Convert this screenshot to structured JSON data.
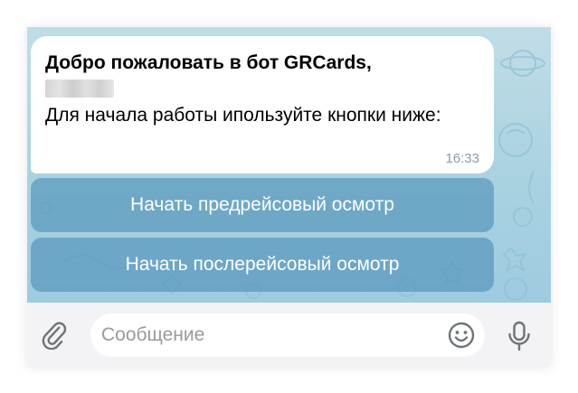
{
  "message": {
    "title": "Добро пожаловать в бот GRCards,",
    "body": "Для начала работы ипользуйте кнопки ниже:",
    "time": "16:33"
  },
  "keyboard": {
    "buttons": [
      {
        "label": "Начать предрейсовый осмотр"
      },
      {
        "label": "Начать послерейсовый осмотр"
      }
    ]
  },
  "composer": {
    "placeholder": "Сообщение",
    "value": ""
  },
  "icons": {
    "attach": "paperclip-icon",
    "emoji": "smiley-icon",
    "mic": "microphone-icon"
  },
  "colors": {
    "chat_background": "#a9d2e0",
    "keyboard_button": "#4e8eb8",
    "bubble": "#ffffff",
    "timestamp": "#8e9ba6",
    "icon_gray": "#6f7478"
  }
}
